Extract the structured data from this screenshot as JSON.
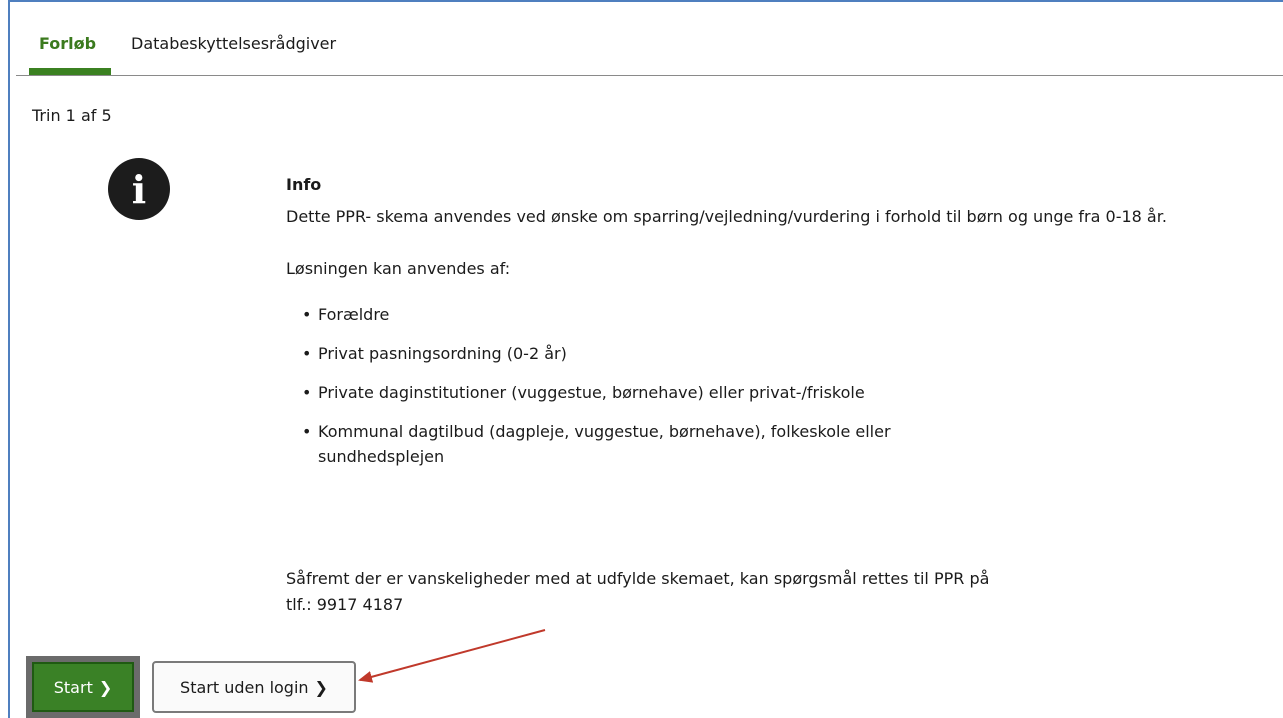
{
  "tabs": [
    {
      "label": "Forløb",
      "active": true
    },
    {
      "label": "Databeskyttelsesrådgiver",
      "active": false
    }
  ],
  "step_label": "Trin 1 af 5",
  "info": {
    "icon": "info-circle-icon",
    "title": "Info",
    "description": "Dette PPR- skema anvendes ved ønske om sparring/vejledning/vurdering i forhold til børn og unge fra 0-18 år.",
    "subheading": "Løsningen kan anvendes af:",
    "items": [
      "Forældre",
      "Privat pasningsordning (0-2 år)",
      "Private daginstitutioner (vuggestue, børnehave) eller privat-/friskole",
      "Kommunal dagtilbud (dagpleje, vuggestue, børnehave), folkeskole eller sundhedsplejen"
    ],
    "contact_line1": "Såfremt der er vanskeligheder med at udfylde skemaet, kan spørgsmål rettes til PPR på",
    "contact_line2": "tlf.: 9917 4187"
  },
  "buttons": {
    "start": "Start",
    "start_no_login": "Start uden login",
    "chevron": "❯"
  },
  "colors": {
    "accent_green": "#3a8126",
    "annotation_arrow": "#c0392b",
    "frame_blue": "#4f7fbf"
  }
}
